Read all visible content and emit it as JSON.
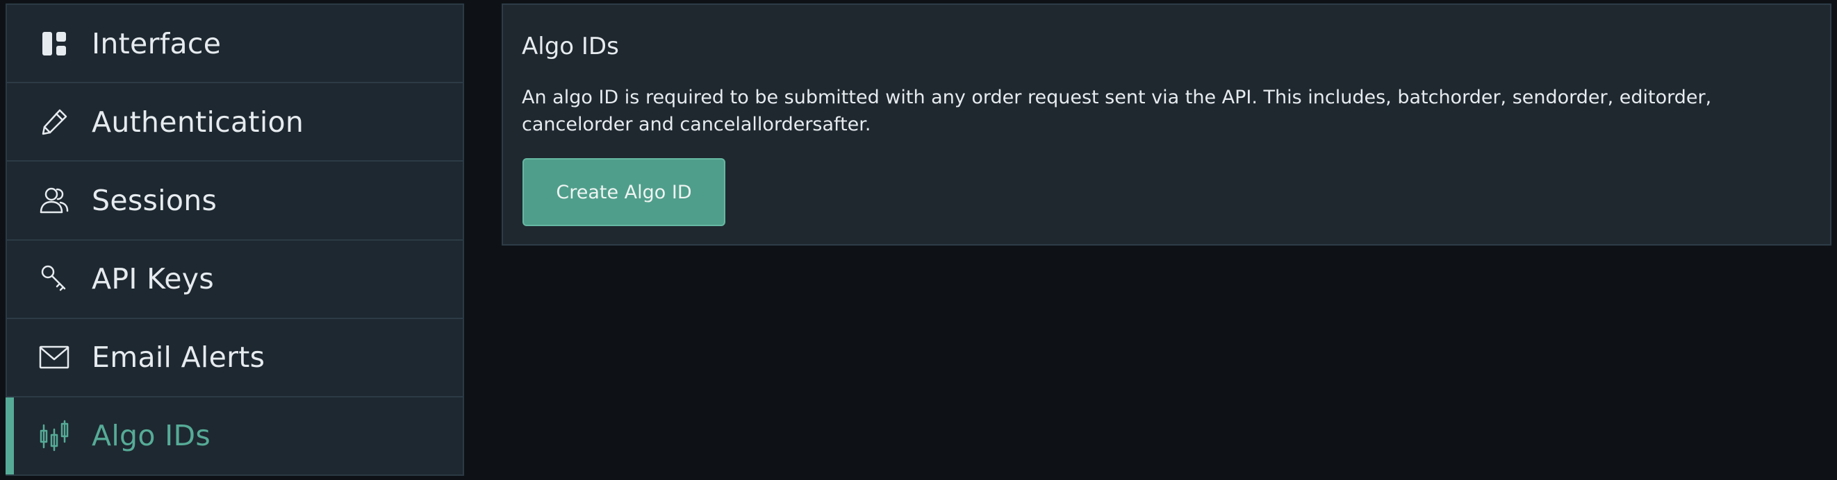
{
  "sidebar": {
    "items": [
      {
        "label": "Interface",
        "icon": "dashboard-icon"
      },
      {
        "label": "Authentication",
        "icon": "pen-icon"
      },
      {
        "label": "Sessions",
        "icon": "users-icon"
      },
      {
        "label": "API Keys",
        "icon": "key-icon"
      },
      {
        "label": "Email Alerts",
        "icon": "envelope-icon"
      },
      {
        "label": "Algo IDs",
        "icon": "candlestick-icon",
        "active": true
      }
    ]
  },
  "panel": {
    "title": "Algo IDs",
    "description": "An algo ID is required to be submitted with any order request sent via the API. This includes, batchorder, sendorder, editorder, cancelorder and cancelallordersafter.",
    "button_label": "Create Algo ID"
  },
  "colors": {
    "accent": "#56ab97",
    "button": "#4f9e8b",
    "page_background": "#0e1216",
    "panel_background": "#1f282f",
    "text": "#e6ebef"
  }
}
